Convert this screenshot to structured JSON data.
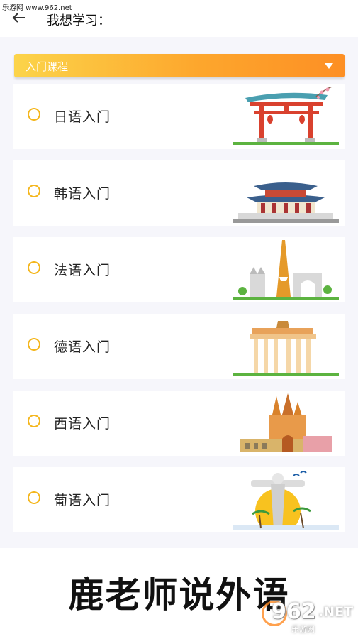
{
  "watermark_top": "乐游网 www.962.net",
  "header": {
    "title": "我想学习："
  },
  "dropdown": {
    "selected": "入门课程"
  },
  "courses": [
    {
      "label": "日语入门",
      "icon": "torii-gate-illustration"
    },
    {
      "label": "韩语入门",
      "icon": "korean-palace-illustration"
    },
    {
      "label": "法语入门",
      "icon": "eiffel-tower-illustration"
    },
    {
      "label": "德语入门",
      "icon": "brandenburg-gate-illustration"
    },
    {
      "label": "西语入门",
      "icon": "sagrada-familia-illustration"
    },
    {
      "label": "葡语入门",
      "icon": "christ-redeemer-illustration"
    }
  ],
  "banner": {
    "slogan": "鹿老师说外语",
    "brand_number": "962",
    "brand_suffix": ".NET",
    "brand_cn": "乐游网"
  },
  "colors": {
    "accent": "#fda72d",
    "radio": "#f4b61d",
    "background": "#f6f6fb"
  }
}
